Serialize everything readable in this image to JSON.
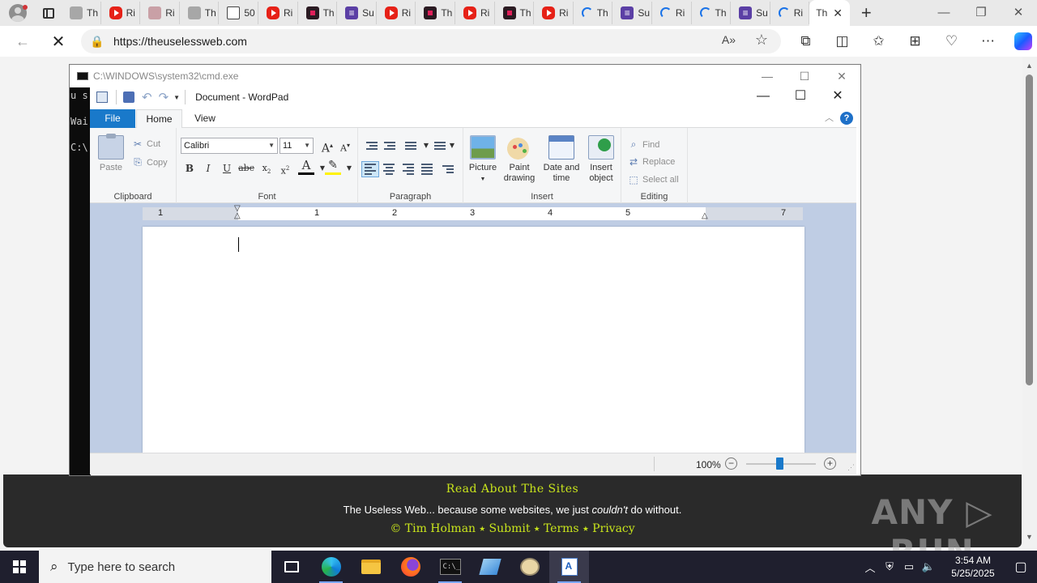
{
  "browser": {
    "tabs": [
      {
        "icon": "generic-page-icon",
        "label": "Th"
      },
      {
        "icon": "youtube-icon",
        "label": "Ri"
      },
      {
        "icon": "pink-page-icon",
        "label": "Ri"
      },
      {
        "icon": "gray-page-icon",
        "label": "Th"
      },
      {
        "icon": "document-icon",
        "label": "50"
      },
      {
        "icon": "youtube-icon",
        "label": "Ri"
      },
      {
        "icon": "dark-site-icon",
        "label": "Th"
      },
      {
        "icon": "purple-list-icon",
        "label": "Su"
      },
      {
        "icon": "youtube-icon",
        "label": "Ri"
      },
      {
        "icon": "dark-site-icon",
        "label": "Th"
      },
      {
        "icon": "youtube-icon",
        "label": "Ri"
      },
      {
        "icon": "dark-site-icon",
        "label": "Th"
      },
      {
        "icon": "youtube-icon",
        "label": "Ri"
      },
      {
        "icon": "loading-icon",
        "label": "Th"
      },
      {
        "icon": "purple-list-icon",
        "label": "Su"
      },
      {
        "icon": "loading-icon",
        "label": "Ri"
      },
      {
        "icon": "loading-icon",
        "label": "Th"
      },
      {
        "icon": "purple-list-icon",
        "label": "Su"
      },
      {
        "icon": "loading-icon",
        "label": "Ri"
      }
    ],
    "active_tab": {
      "label": "Th",
      "close": "✕"
    },
    "new_tab": "+",
    "window_controls": {
      "minimize": "—",
      "restore": "❐",
      "close": "✕"
    },
    "url": "https://theuselessweb.com"
  },
  "webpage": {
    "footer": {
      "about": "Read About The Sites",
      "tagline_pre": "The Useless Web... because some websites, we just ",
      "tagline_em": "couldn't",
      "tagline_post": " do without.",
      "credit": "© Tim Holman ⭑ Submit ⭑ Terms ⭑ Privacy"
    },
    "watermark": "ANY ▷ RUN"
  },
  "cmd": {
    "title": "C:\\WINDOWS\\system32\\cmd.exe",
    "lines": [
      "u s",
      "Wai",
      "C:\\"
    ]
  },
  "wordpad": {
    "title": "Document - WordPad",
    "tabs": {
      "file": "File",
      "home": "Home",
      "view": "View"
    },
    "help": "?",
    "clipboard": {
      "paste": "Paste",
      "cut": "Cut",
      "copy": "Copy",
      "label": "Clipboard"
    },
    "font": {
      "family": "Calibri",
      "size": "11",
      "label": "Font"
    },
    "paragraph": {
      "label": "Paragraph"
    },
    "insert": {
      "picture": "Picture",
      "paint1": "Paint",
      "paint2": "drawing",
      "date1": "Date and",
      "date2": "time",
      "obj1": "Insert",
      "obj2": "object",
      "label": "Insert"
    },
    "editing": {
      "find": "Find",
      "replace": "Replace",
      "select_all": "Select all",
      "label": "Editing"
    },
    "ruler_numbers": [
      "1",
      "1",
      "2",
      "3",
      "4",
      "5",
      "7"
    ],
    "zoom": "100%"
  },
  "taskbar": {
    "search_placeholder": "Type here to search",
    "time": "3:54 AM",
    "date": "5/25/2025"
  },
  "colors": {
    "footer_bg": "#2a2a2a",
    "footer_accent": "#c8e41c",
    "wordpad_file_tab": "#1979ca",
    "taskbar_bg": "#1f1f2e"
  }
}
